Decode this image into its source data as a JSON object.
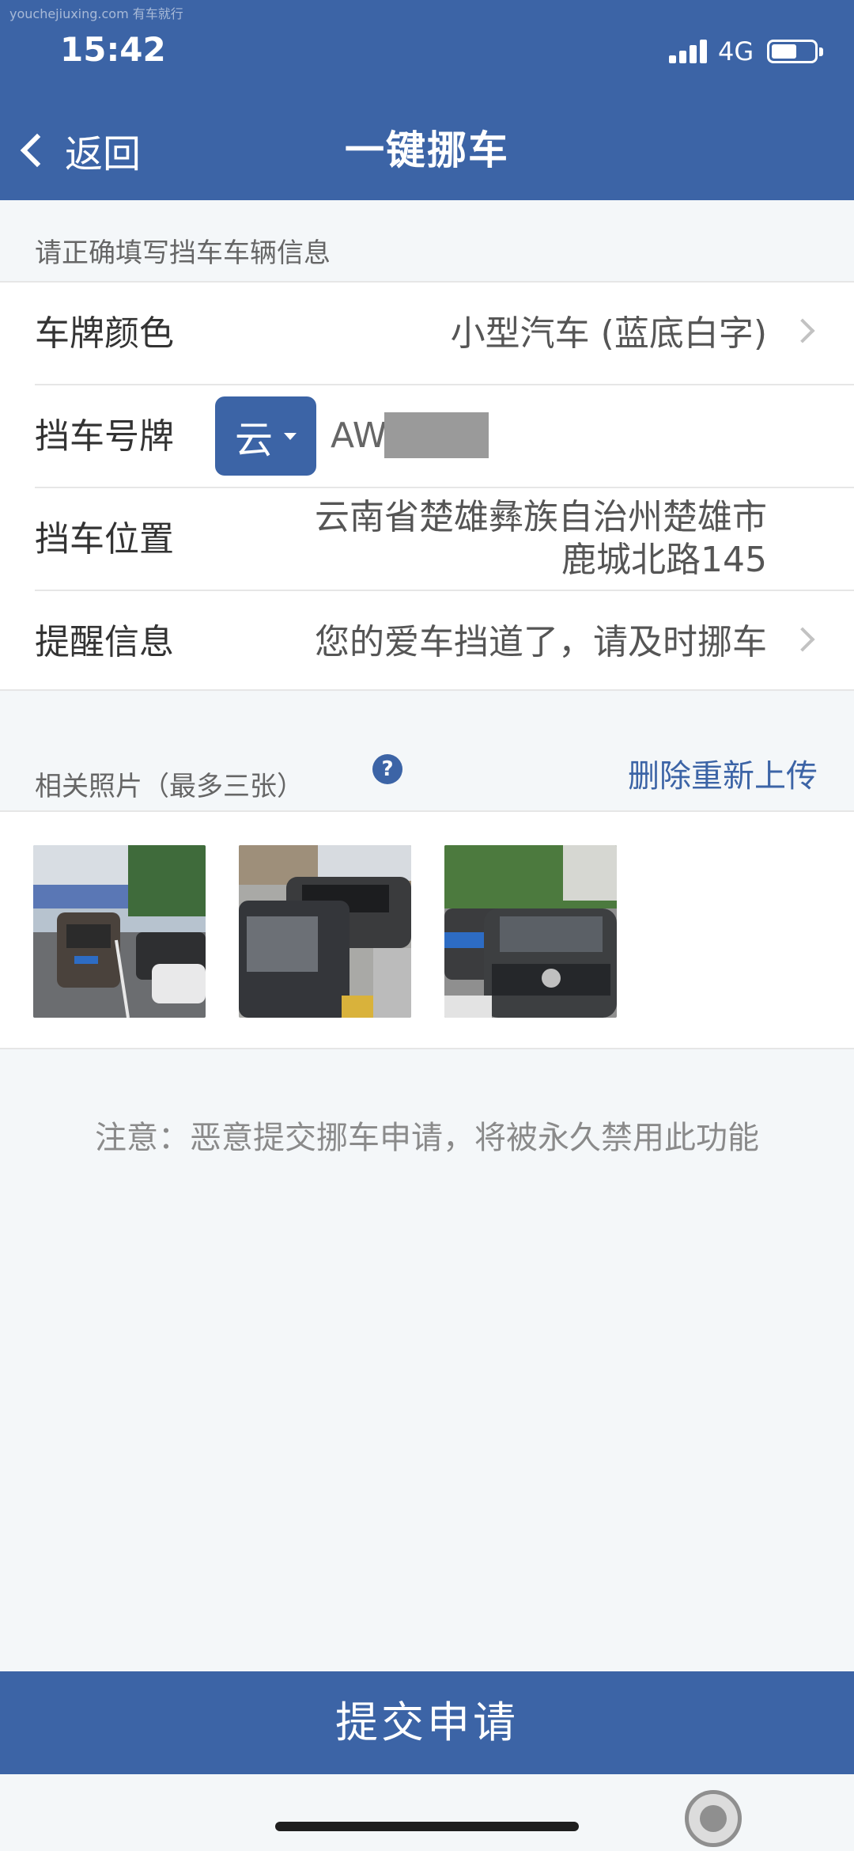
{
  "watermark": "youchejiuxing.com 有车就行",
  "status": {
    "time": "15:42",
    "network": "4G"
  },
  "nav": {
    "back_label": "返回",
    "title": "一键挪车"
  },
  "form": {
    "section_hint": "请正确填写挡车车辆信息",
    "plate_color_label": "车牌颜色",
    "plate_color_value": "小型汽车 (蓝底白字)",
    "plate_label": "挡车号牌",
    "plate_province": "云",
    "plate_number_prefix": "AW",
    "location_label": "挡车位置",
    "location_line1": "云南省楚雄彝族自治州楚雄市",
    "location_line2": "鹿城北路145",
    "reminder_label": "提醒信息",
    "reminder_value": "您的爱车挡道了，请及时挪车"
  },
  "photos": {
    "label": "相关照片（最多三张）",
    "help_symbol": "?",
    "delete_reupload": "删除重新上传",
    "items": [
      "photo-1",
      "photo-2",
      "photo-3"
    ]
  },
  "notice": "注意：恶意提交挪车申请，将被永久禁用此功能",
  "submit_label": "提交申请",
  "colors": {
    "primary": "#3c64a6",
    "background": "#f4f7f9"
  },
  "icons": [
    "chevron-left-icon",
    "chevron-right-icon",
    "help-icon",
    "caret-down-icon",
    "signal-icon",
    "battery-icon"
  ]
}
